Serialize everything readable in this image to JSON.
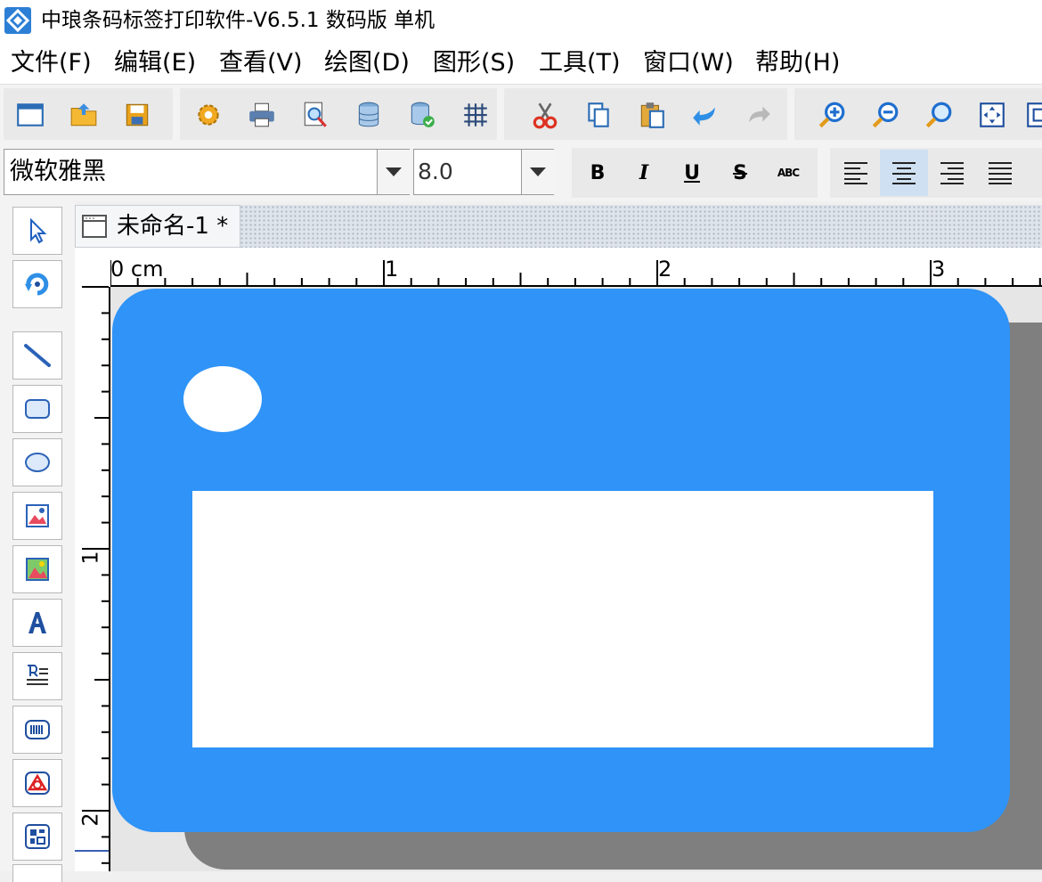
{
  "window": {
    "title": "中琅条码标签打印软件-V6.5.1 数码版 单机"
  },
  "menu": {
    "items": [
      "文件(F)",
      "编辑(E)",
      "查看(V)",
      "绘图(D)",
      "图形(S)",
      "工具(T)",
      "窗口(W)",
      "帮助(H)"
    ]
  },
  "toolbar": {
    "buttons": [
      "new-icon",
      "open-icon",
      "save-icon",
      "settings-icon",
      "print-icon",
      "print-preview-icon",
      "database-icon",
      "database-refresh-icon",
      "grid-icon",
      "cut-icon",
      "copy-icon",
      "paste-icon",
      "undo-icon",
      "redo-icon",
      "zoom-in-icon",
      "zoom-out-icon",
      "zoom-icon",
      "fit-page-icon"
    ]
  },
  "format_bar": {
    "font_name": "微软雅黑",
    "font_size": "8.0",
    "bold": "B",
    "italic": "I",
    "underline": "U",
    "strike": "S",
    "case": "ABC",
    "alignment_selected": "center"
  },
  "palette": {
    "tools": [
      "pointer-icon",
      "rotate-icon",
      "line-icon",
      "rounded-rect-icon",
      "ellipse-icon",
      "image-icon",
      "picture-icon",
      "text-icon",
      "rich-text-icon",
      "barcode-icon",
      "shape-icon",
      "qrcode-icon"
    ]
  },
  "document": {
    "tab_title": "未命名-1 *"
  },
  "ruler": {
    "unit": "cm",
    "h_labels": [
      "0 cm",
      "1",
      "2",
      "3"
    ],
    "v_labels": [
      "1",
      "2"
    ]
  },
  "label": {
    "background_color": "#2f93f7",
    "element_color": "#ffffff",
    "shadow_color": "#7f7f7f"
  }
}
